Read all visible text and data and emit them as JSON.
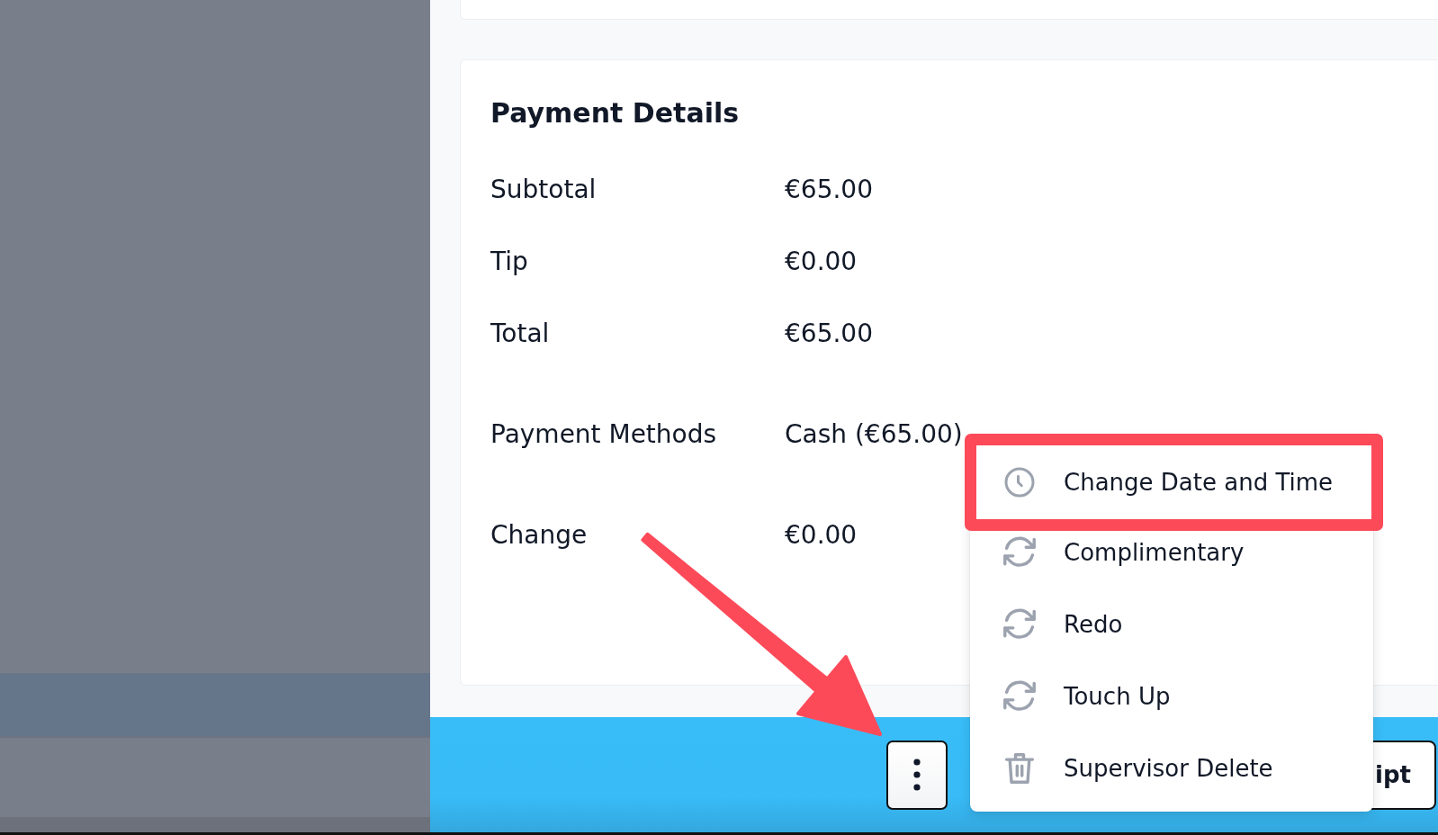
{
  "payment_details": {
    "title": "Payment Details",
    "rows": [
      {
        "kind": "amount",
        "label": "Subtotal",
        "value": "€65.00"
      },
      {
        "kind": "amount",
        "label": "Tip",
        "value": "€0.00"
      },
      {
        "kind": "amount",
        "label": "Total",
        "value": "€65.00"
      },
      {
        "kind": "method",
        "label": "Payment Methods",
        "value": "Cash (€65.00)"
      },
      {
        "kind": "method",
        "label": "Change",
        "value": "€0.00"
      }
    ]
  },
  "action_bar": {
    "buttons": [
      {
        "kind": "more"
      },
      {
        "kind": "text",
        "label": "ipt"
      }
    ]
  },
  "menu": {
    "items": [
      {
        "kind": "time",
        "label": "Change Date and Time",
        "highlighted": true
      },
      {
        "kind": "repeat",
        "label": "Complimentary",
        "highlighted": false
      },
      {
        "kind": "repeat",
        "label": "Redo",
        "highlighted": false
      },
      {
        "kind": "repeat",
        "label": "Touch Up",
        "highlighted": false
      },
      {
        "kind": "delete",
        "label": "Supervisor Delete",
        "highlighted": false
      }
    ]
  }
}
